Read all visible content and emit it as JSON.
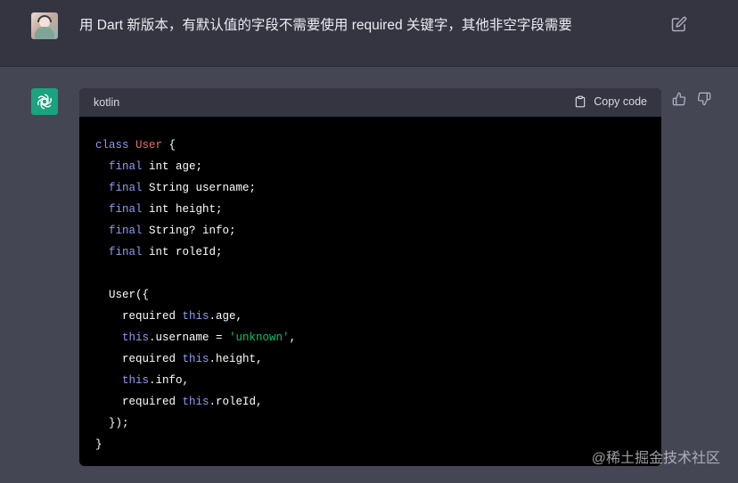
{
  "user_message": {
    "text": "用 Dart 新版本，有默认值的字段不需要使用 required 关键字，其他非空字段需要"
  },
  "assistant": {
    "code_block": {
      "language": "kotlin",
      "copy_label": "Copy code",
      "lines": [
        [
          {
            "t": "class ",
            "c": "kw"
          },
          {
            "t": "User",
            "c": "cls"
          },
          {
            "t": " {",
            "c": ""
          }
        ],
        [
          {
            "t": "  ",
            "c": ""
          },
          {
            "t": "final",
            "c": "kw"
          },
          {
            "t": " int age;",
            "c": ""
          }
        ],
        [
          {
            "t": "  ",
            "c": ""
          },
          {
            "t": "final",
            "c": "kw"
          },
          {
            "t": " String username;",
            "c": ""
          }
        ],
        [
          {
            "t": "  ",
            "c": ""
          },
          {
            "t": "final",
            "c": "kw"
          },
          {
            "t": " int height;",
            "c": ""
          }
        ],
        [
          {
            "t": "  ",
            "c": ""
          },
          {
            "t": "final",
            "c": "kw"
          },
          {
            "t": " String? info;",
            "c": ""
          }
        ],
        [
          {
            "t": "  ",
            "c": ""
          },
          {
            "t": "final",
            "c": "kw"
          },
          {
            "t": " int roleId;",
            "c": ""
          }
        ],
        [
          {
            "t": "",
            "c": ""
          }
        ],
        [
          {
            "t": "  User({",
            "c": ""
          }
        ],
        [
          {
            "t": "    required ",
            "c": ""
          },
          {
            "t": "this",
            "c": "kw"
          },
          {
            "t": ".age,",
            "c": ""
          }
        ],
        [
          {
            "t": "    ",
            "c": ""
          },
          {
            "t": "this",
            "c": "kw"
          },
          {
            "t": ".username = ",
            "c": ""
          },
          {
            "t": "'unknown'",
            "c": "str"
          },
          {
            "t": ",",
            "c": ""
          }
        ],
        [
          {
            "t": "    required ",
            "c": ""
          },
          {
            "t": "this",
            "c": "kw"
          },
          {
            "t": ".height,",
            "c": ""
          }
        ],
        [
          {
            "t": "    ",
            "c": ""
          },
          {
            "t": "this",
            "c": "kw"
          },
          {
            "t": ".info,",
            "c": ""
          }
        ],
        [
          {
            "t": "    required ",
            "c": ""
          },
          {
            "t": "this",
            "c": "kw"
          },
          {
            "t": ".roleId,",
            "c": ""
          }
        ],
        [
          {
            "t": "  });",
            "c": ""
          }
        ],
        [
          {
            "t": "}",
            "c": ""
          }
        ]
      ]
    }
  },
  "icons": {
    "edit": "pencil-square-icon",
    "copy": "clipboard-icon",
    "like": "thumbs-up-icon",
    "dislike": "thumbs-down-icon",
    "assistant_logo": "openai-logo-icon"
  },
  "colors": {
    "user_bg": "#343541",
    "assistant_bg": "#444654",
    "code_bg": "#000000",
    "keyword": "#8f9cf7",
    "class_name": "#ef6b73",
    "string": "#00c26b",
    "assistant_logo_bg": "#19a37f"
  },
  "watermark": "@稀土掘金技术社区"
}
